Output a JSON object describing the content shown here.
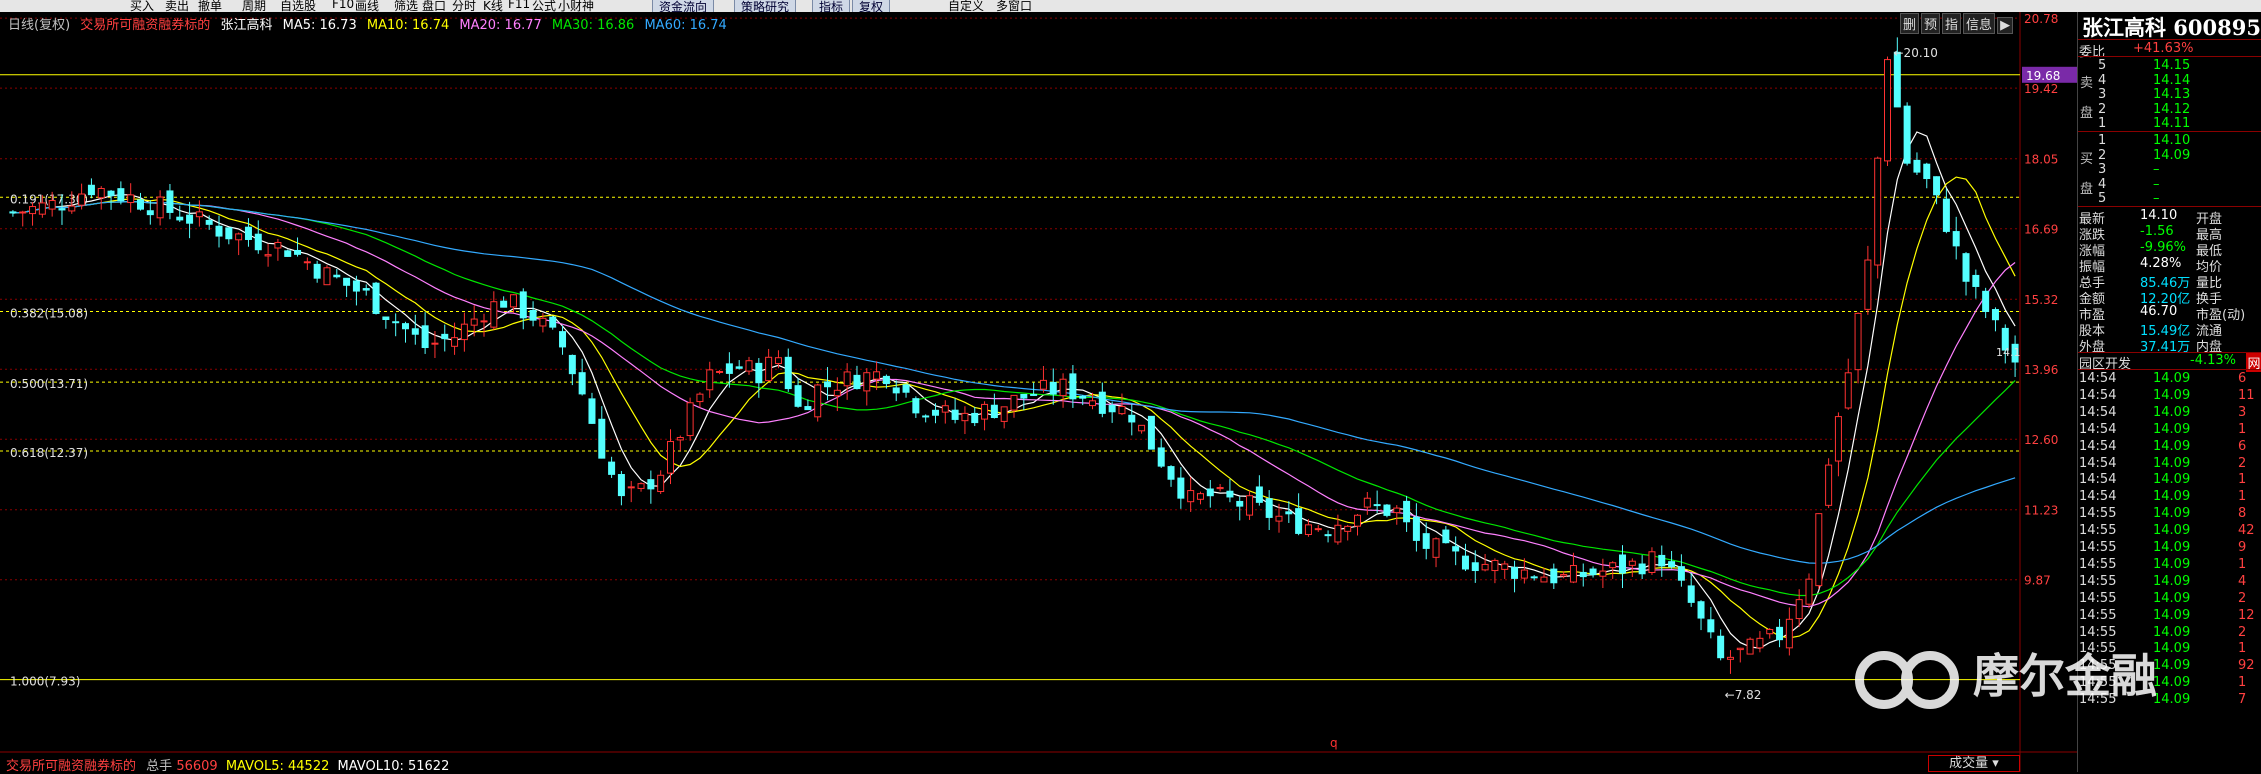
{
  "toolbar": {
    "items": [
      "买入",
      "卖出",
      "撤单",
      "周期",
      "自选股",
      "F10",
      "画线",
      "筛选",
      "盘口",
      "分时",
      "K线",
      "F11",
      "公式",
      "小财神",
      "资金流向",
      "策略研究",
      "指标",
      "复权",
      "自定义",
      "多窗口"
    ]
  },
  "legend": {
    "period": "日线(复权)",
    "margin_tag": "交易所可融资融券标的",
    "stock": "张江高科",
    "ma5": "MA5: 16.73",
    "ma10": "MA10: 16.74",
    "ma20": "MA20: 16.77",
    "ma30": "MA30: 16.86",
    "ma60": "MA60: 16.74"
  },
  "colors": {
    "up": "#ff3232",
    "down": "#54ffff",
    "ma5": "#ffffff",
    "ma10": "#ffff00",
    "ma20": "#ff80ff",
    "ma30": "#00e600",
    "ma60": "#33aaff",
    "fib": "#ffff00",
    "grid": "#8b0000"
  },
  "price_axis": {
    "labels": [
      "20.78",
      "19.42",
      "18.05",
      "16.69",
      "15.32",
      "13.96",
      "12.60",
      "11.23",
      "9.87"
    ],
    "current_label": "19.68",
    "min": 7.3,
    "max": 20.9
  },
  "fib_levels": [
    {
      "label": "0.191(17.30)",
      "price": 17.3
    },
    {
      "label": "0.382(15.08)",
      "price": 15.08
    },
    {
      "label": "0.500(13.71)",
      "price": 13.71
    },
    {
      "label": "0.618(12.37)",
      "price": 12.37
    },
    {
      "label": "1.000(7.93)",
      "price": 7.93
    }
  ],
  "highline": {
    "price": 19.68
  },
  "annotations": {
    "high": "20.10",
    "low": "7.82",
    "current": "14.1"
  },
  "chart_data": {
    "type": "candlestick",
    "n_bars": 205,
    "anchors": [
      [
        0,
        17.0
      ],
      [
        5,
        17.2
      ],
      [
        8,
        17.5
      ],
      [
        12,
        17.3
      ],
      [
        18,
        16.9
      ],
      [
        22,
        16.6
      ],
      [
        28,
        16.3
      ],
      [
        32,
        15.8
      ],
      [
        36,
        15.4
      ],
      [
        39,
        14.9
      ],
      [
        42,
        14.4
      ],
      [
        45,
        14.6
      ],
      [
        48,
        15.1
      ],
      [
        50,
        15.3
      ],
      [
        53,
        15.0
      ],
      [
        56,
        14.4
      ],
      [
        58,
        13.5
      ],
      [
        60,
        12.4
      ],
      [
        62,
        11.4
      ],
      [
        64,
        11.6
      ],
      [
        66,
        12.0
      ],
      [
        69,
        13.1
      ],
      [
        71,
        13.8
      ],
      [
        74,
        14.0
      ],
      [
        76,
        13.9
      ],
      [
        78,
        14.2
      ],
      [
        80,
        13.2
      ],
      [
        82,
        13.6
      ],
      [
        86,
        13.8
      ],
      [
        89,
        13.9
      ],
      [
        92,
        13.3
      ],
      [
        96,
        13.0
      ],
      [
        100,
        13.2
      ],
      [
        104,
        13.5
      ],
      [
        107,
        13.6
      ],
      [
        110,
        13.4
      ],
      [
        114,
        13.1
      ],
      [
        117,
        12.2
      ],
      [
        120,
        11.4
      ],
      [
        122,
        11.5
      ],
      [
        126,
        11.3
      ],
      [
        130,
        11.0
      ],
      [
        134,
        10.9
      ],
      [
        138,
        11.3
      ],
      [
        141,
        11.2
      ],
      [
        143,
        10.6
      ],
      [
        147,
        10.3
      ],
      [
        152,
        10.1
      ],
      [
        158,
        9.9
      ],
      [
        164,
        10.1
      ],
      [
        168,
        10.3
      ],
      [
        171,
        9.4
      ],
      [
        174,
        8.3
      ],
      [
        177,
        8.5
      ],
      [
        180,
        8.8
      ],
      [
        183,
        10.0
      ],
      [
        185,
        12.2
      ],
      [
        187,
        13.9
      ],
      [
        189,
        16.0
      ],
      [
        191,
        20.1
      ],
      [
        193,
        18.0
      ],
      [
        195,
        17.6
      ],
      [
        197,
        16.8
      ],
      [
        199,
        15.7
      ],
      [
        201,
        15.1
      ],
      [
        203,
        14.4
      ],
      [
        204,
        14.1
      ]
    ],
    "ma_colors": [
      "#ffffff",
      "#ffff00",
      "#ff80ff",
      "#00e600",
      "#33aaff"
    ],
    "ma_periods": [
      5,
      10,
      20,
      30,
      60
    ],
    "last_close": 14.1
  },
  "right_panel": {
    "title": "张江高科 600895",
    "webi_label": "委比",
    "webi_value": "+41.63%",
    "sell_label_1": "卖",
    "sell_label_2": "盘",
    "buy_label_1": "买",
    "buy_label_2": "盘",
    "asks": [
      [
        "5",
        "14.15"
      ],
      [
        "4",
        "14.14"
      ],
      [
        "3",
        "14.13"
      ],
      [
        "2",
        "14.12"
      ],
      [
        "1",
        "14.11"
      ]
    ],
    "bids": [
      [
        "1",
        "14.10"
      ],
      [
        "2",
        "14.09"
      ],
      [
        "3",
        "–"
      ],
      [
        "4",
        "–"
      ],
      [
        "5",
        "–"
      ]
    ],
    "stats": [
      [
        "最新",
        "14.10",
        "开盘"
      ],
      [
        "涨跌",
        "-1.56",
        "最高"
      ],
      [
        "涨幅",
        "-9.96%",
        "最低"
      ],
      [
        "振幅",
        "4.28%",
        "均价"
      ],
      [
        "总手",
        "85.46万",
        "量比"
      ],
      [
        "金额",
        "12.20亿",
        "换手"
      ],
      [
        "市盈",
        "46.70",
        "市盈(动)"
      ],
      [
        "股本",
        "15.49亿",
        "流通"
      ],
      [
        "外盘",
        "37.41万",
        "内盘"
      ]
    ],
    "zone_label": "园区开发",
    "zone_value": "-4.13%",
    "zone_btn": "网",
    "ticks": [
      [
        "14:54",
        "14.09",
        "6"
      ],
      [
        "14:54",
        "14.09",
        "11"
      ],
      [
        "14:54",
        "14.09",
        "3"
      ],
      [
        "14:54",
        "14.09",
        "1"
      ],
      [
        "14:54",
        "14.09",
        "6"
      ],
      [
        "14:54",
        "14.09",
        "2"
      ],
      [
        "14:54",
        "14.09",
        "1"
      ],
      [
        "14:54",
        "14.09",
        "1"
      ],
      [
        "14:55",
        "14.09",
        "8"
      ],
      [
        "14:55",
        "14.09",
        "42"
      ],
      [
        "14:55",
        "14.09",
        "9"
      ],
      [
        "14:55",
        "14.09",
        "1"
      ],
      [
        "14:55",
        "14.09",
        "4"
      ],
      [
        "14:55",
        "14.09",
        "2"
      ],
      [
        "14:55",
        "14.09",
        "12"
      ],
      [
        "14:55",
        "14.09",
        "2"
      ],
      [
        "14:55",
        "14.09",
        "1"
      ],
      [
        "14:55",
        "14.09",
        "92"
      ],
      [
        "14:55",
        "14.09",
        "1"
      ],
      [
        "14:55",
        "14.09",
        "7"
      ]
    ]
  },
  "top_icons": [
    "删",
    "预",
    "指",
    "信息",
    "▶"
  ],
  "bottom": {
    "margin_tag": "交易所可融资融券标的",
    "vol_label": "总手",
    "vol_value": "56609",
    "mavol5": "MAVOL5: 44522",
    "mavol10": "MAVOL10: 51622",
    "vol_btn": "成交量",
    "q_marker": "q"
  },
  "watermark": "摩尔金融"
}
